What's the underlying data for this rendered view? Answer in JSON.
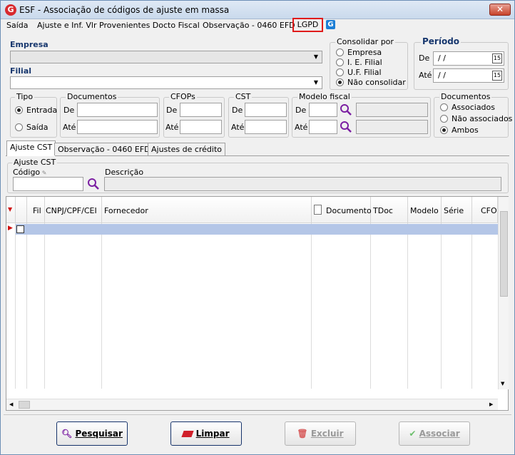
{
  "window": {
    "title": "ESF - Associação de códigos de ajuste em massa",
    "close": "✕"
  },
  "menu": {
    "items": [
      "Saída",
      "Ajuste e Inf. Vlr Provenientes Docto Fiscal",
      "Observação - 0460 EFD",
      "LGPD"
    ]
  },
  "filters": {
    "empresa_label": "Empresa",
    "filial_label": "Filial",
    "consolidar": {
      "title": "Consolidar por",
      "options": [
        "Empresa",
        "I. E. Filial",
        "U.F. Filial",
        "Não consolidar"
      ],
      "selected": "Não consolidar"
    },
    "periodo": {
      "title": "Período",
      "de_label": "De",
      "ate_label": "Até",
      "de_value": " /  /",
      "ate_value": " /  /",
      "cal": "15"
    },
    "tipo": {
      "title": "Tipo",
      "options": [
        "Entrada",
        "Saída"
      ],
      "selected": "Entrada"
    },
    "documentos": {
      "title": "Documentos",
      "de": "De",
      "ate": "Até"
    },
    "cfops": {
      "title": "CFOPs",
      "de": "De",
      "ate": "Até"
    },
    "cst": {
      "title": "CST",
      "de": "De",
      "ate": "Até"
    },
    "modelo": {
      "title": "Modelo fiscal",
      "de": "De",
      "ate": "Até"
    },
    "documentos_assoc": {
      "title": "Documentos",
      "options": [
        "Associados",
        "Não associados",
        "Ambos"
      ],
      "selected": "Ambos"
    }
  },
  "tabs": [
    "Ajuste CST",
    "Observação - 0460 EFD",
    "Ajustes de crédito"
  ],
  "ajuste": {
    "group_title": "Ajuste CST",
    "codigo_label": "Código",
    "descricao_label": "Descrição"
  },
  "grid": {
    "columns": [
      "Fil",
      "CNPJ/CPF/CEI",
      "Fornecedor",
      "Documento",
      "TDoc",
      "Modelo",
      "Série",
      "CFOP"
    ]
  },
  "buttons": {
    "pesquisar": "Pesquisar",
    "limpar": "Limpar",
    "excluir": "Excluir",
    "associar": "Associar"
  },
  "colors": {
    "accent": "#17376e",
    "highlight": "#e01b1b",
    "selection": "#b4c6e7"
  }
}
